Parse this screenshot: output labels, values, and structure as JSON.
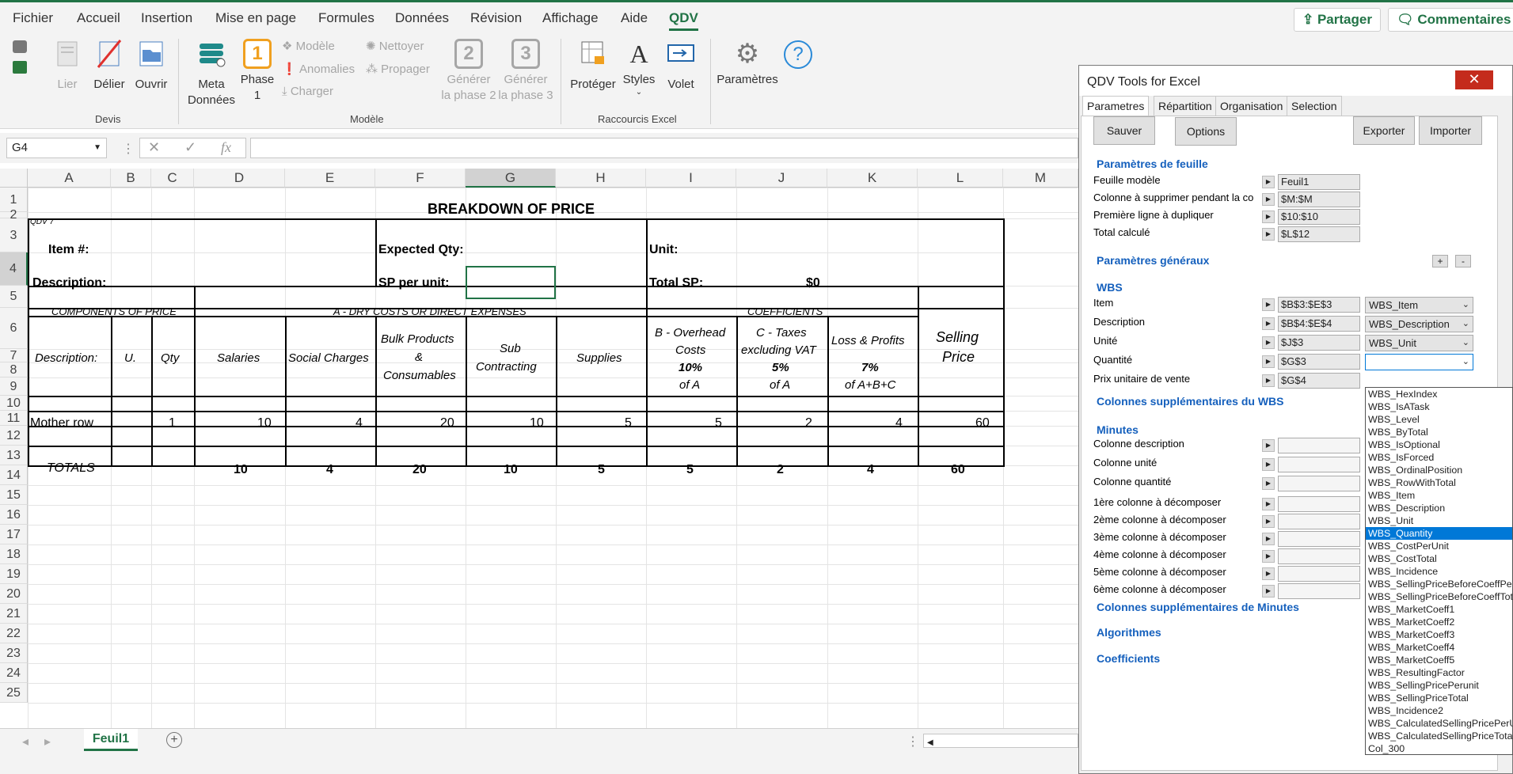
{
  "menu": {
    "tabs": [
      "Fichier",
      "Accueil",
      "Insertion",
      "Mise en page",
      "Formules",
      "Données",
      "Révision",
      "Affichage",
      "Aide",
      "QDV"
    ],
    "active": "QDV",
    "share_label": "Partager",
    "comments_label": "Commentaires"
  },
  "ribbon": {
    "devis": {
      "group_label": "Devis",
      "lier": "Lier",
      "delier": "Délier",
      "ouvrir": "Ouvrir"
    },
    "modele": {
      "group_label": "Modèle",
      "meta_l1": "Meta",
      "meta_l2": "Données",
      "phase_l1": "Phase",
      "phase_l2": "1",
      "phase_num": "1",
      "modele": "Modèle",
      "anomalies": "Anomalies",
      "charger": "Charger",
      "nettoyer": "Nettoyer",
      "propager": "Propager",
      "gen2_l1": "Générer",
      "gen2_l2": "la phase 2",
      "gen2_num": "2",
      "gen3_l1": "Générer",
      "gen3_l2": "la phase 3",
      "gen3_num": "3"
    },
    "raccourcis": {
      "group_label": "Raccourcis Excel",
      "proteger": "Protéger",
      "styles": "Styles",
      "volet": "Volet"
    },
    "parametres": "Paramètres"
  },
  "formula_bar": {
    "name_box": "G4",
    "formula": ""
  },
  "sheet": {
    "columns": [
      "A",
      "B",
      "C",
      "D",
      "E",
      "F",
      "G",
      "H",
      "I",
      "J",
      "K",
      "L",
      "M"
    ],
    "rows": [
      "1",
      "2",
      "3",
      "4",
      "5",
      "6",
      "7",
      "8",
      "9",
      "10",
      "11",
      "12",
      "13",
      "14",
      "15",
      "16",
      "17",
      "18",
      "19",
      "20",
      "21",
      "22",
      "23",
      "24",
      "25"
    ],
    "title": "BREAKDOWN OF PRICE",
    "qdv": "QDV 7",
    "item": "Item #:",
    "expected_qty": "Expected Qty:",
    "unit": "Unit:",
    "description": "Description:",
    "sp_per_unit": "SP per unit:",
    "total_sp": "Total SP:",
    "total_sp_value": "$0",
    "components": "COMPONENTS OF PRICE",
    "dry_costs": "A - DRY COSTS OR DIRECT EXPENSES",
    "coefficients": "COEFFICIENTS",
    "h_desc": "Description:",
    "h_u": "U.",
    "h_qty": "Qty",
    "h_sal": "Salaries",
    "h_soc": "Social Charges",
    "h_bulk1": "Bulk Products",
    "h_bulk2": "&",
    "h_bulk3": "Consumables",
    "h_sub1": "Sub",
    "h_sub2": "Contracting",
    "h_sup": "Supplies",
    "h_b1": "B - Overhead",
    "h_b2": "Costs",
    "h_b3": "10%",
    "h_b4": "of A",
    "h_c1": "C - Taxes",
    "h_c2": "excluding VAT",
    "h_c3": "5%",
    "h_c4": "of A",
    "h_l1": "Loss & Profits",
    "h_l3": "7%",
    "h_l4": "of A+B+C",
    "h_sp1": "Selling",
    "h_sp2": "Price",
    "mother": {
      "label": "Mother row",
      "qty": "1",
      "sal": "10",
      "soc": "4",
      "bulk": "20",
      "sub": "10",
      "sup": "5",
      "b": "5",
      "c": "2",
      "l": "4",
      "sp": "60"
    },
    "totals": {
      "label": "TOTALS",
      "sal": "10",
      "soc": "4",
      "bulk": "20",
      "sub": "10",
      "sup": "5",
      "b": "5",
      "c": "2",
      "l": "4",
      "sp": "60"
    },
    "sheet_tab": "Feuil1"
  },
  "panel": {
    "title": "QDV Tools for Excel",
    "close": "✕",
    "tabs": [
      "Parametres",
      "Répartition",
      "Organisation",
      "Selection"
    ],
    "buttons": {
      "sauver": "Sauver",
      "options": "Options",
      "exporter": "Exporter",
      "importer": "Importer"
    },
    "sec_feuille": "Paramètres de feuille",
    "feuille_modele": "Feuille modèle",
    "feuille_modele_val": "Feuil1",
    "col_suppr": "Colonne à supprimer pendant la co",
    "col_suppr_val": "$M:$M",
    "prem_ligne": "Première ligne à dupliquer",
    "prem_ligne_val": "$10:$10",
    "total_calc": "Total calculé",
    "total_calc_val": "$L$12",
    "sec_generaux": "Paramètres généraux",
    "plus": "+",
    "minus": "-",
    "sec_wbs": "WBS",
    "item": "Item",
    "item_val": "$B$3:$E$3",
    "item_dd": "WBS_Item",
    "desc": "Description",
    "desc_val": "$B$4:$E$4",
    "desc_dd": "WBS_Description",
    "unite": "Unité",
    "unite_val": "$J$3",
    "unite_dd": "WBS_Unit",
    "quantite": "Quantité",
    "quantite_val": "$G$3",
    "quantite_dd": "",
    "prix": "Prix unitaire de vente",
    "prix_val": "$G$4",
    "sec_cols_wbs": "Colonnes supplémentaires du WBS",
    "sec_minutes": "Minutes",
    "m_desc": "Colonne description",
    "m_unit": "Colonne unité",
    "m_qty": "Colonne quantité",
    "m_c1": "1ère colonne à décomposer",
    "m_c2": "2ème colonne à décomposer",
    "m_c3": "3ème colonne à décomposer",
    "m_c4": "4ème colonne à décomposer",
    "m_c5": "5ème colonne à décomposer",
    "m_c6": "6ème colonne à décomposer",
    "sec_cols_min": "Colonnes supplémentaires de Minutes",
    "sec_algo": "Algorithmes",
    "sec_coef": "Coefficients",
    "dropdown_selected": "WBS_Quantity",
    "dropdown_options": [
      "WBS_HexIndex",
      "WBS_IsATask",
      "WBS_Level",
      "WBS_ByTotal",
      "WBS_IsOptional",
      "WBS_IsForced",
      "WBS_OrdinalPosition",
      "WBS_RowWithTotal",
      "WBS_Item",
      "WBS_Description",
      "WBS_Unit",
      "WBS_Quantity",
      "WBS_CostPerUnit",
      "WBS_CostTotal",
      "WBS_Incidence",
      "WBS_SellingPriceBeforeCoeffPerUnit",
      "WBS_SellingPriceBeforeCoeffTotal",
      "WBS_MarketCoeff1",
      "WBS_MarketCoeff2",
      "WBS_MarketCoeff3",
      "WBS_MarketCoeff4",
      "WBS_MarketCoeff5",
      "WBS_ResultingFactor",
      "WBS_SellingPricePerunit",
      "WBS_SellingPriceTotal",
      "WBS_Incidence2",
      "WBS_CalculatedSellingPricePerUnit",
      "WBS_CalculatedSellingPriceTotal",
      "Col_300"
    ]
  },
  "colors": {
    "excel_green": "#217346",
    "panel_blue": "#1560bd",
    "close_red": "#c42b1c",
    "select_blue": "#0078d7"
  }
}
